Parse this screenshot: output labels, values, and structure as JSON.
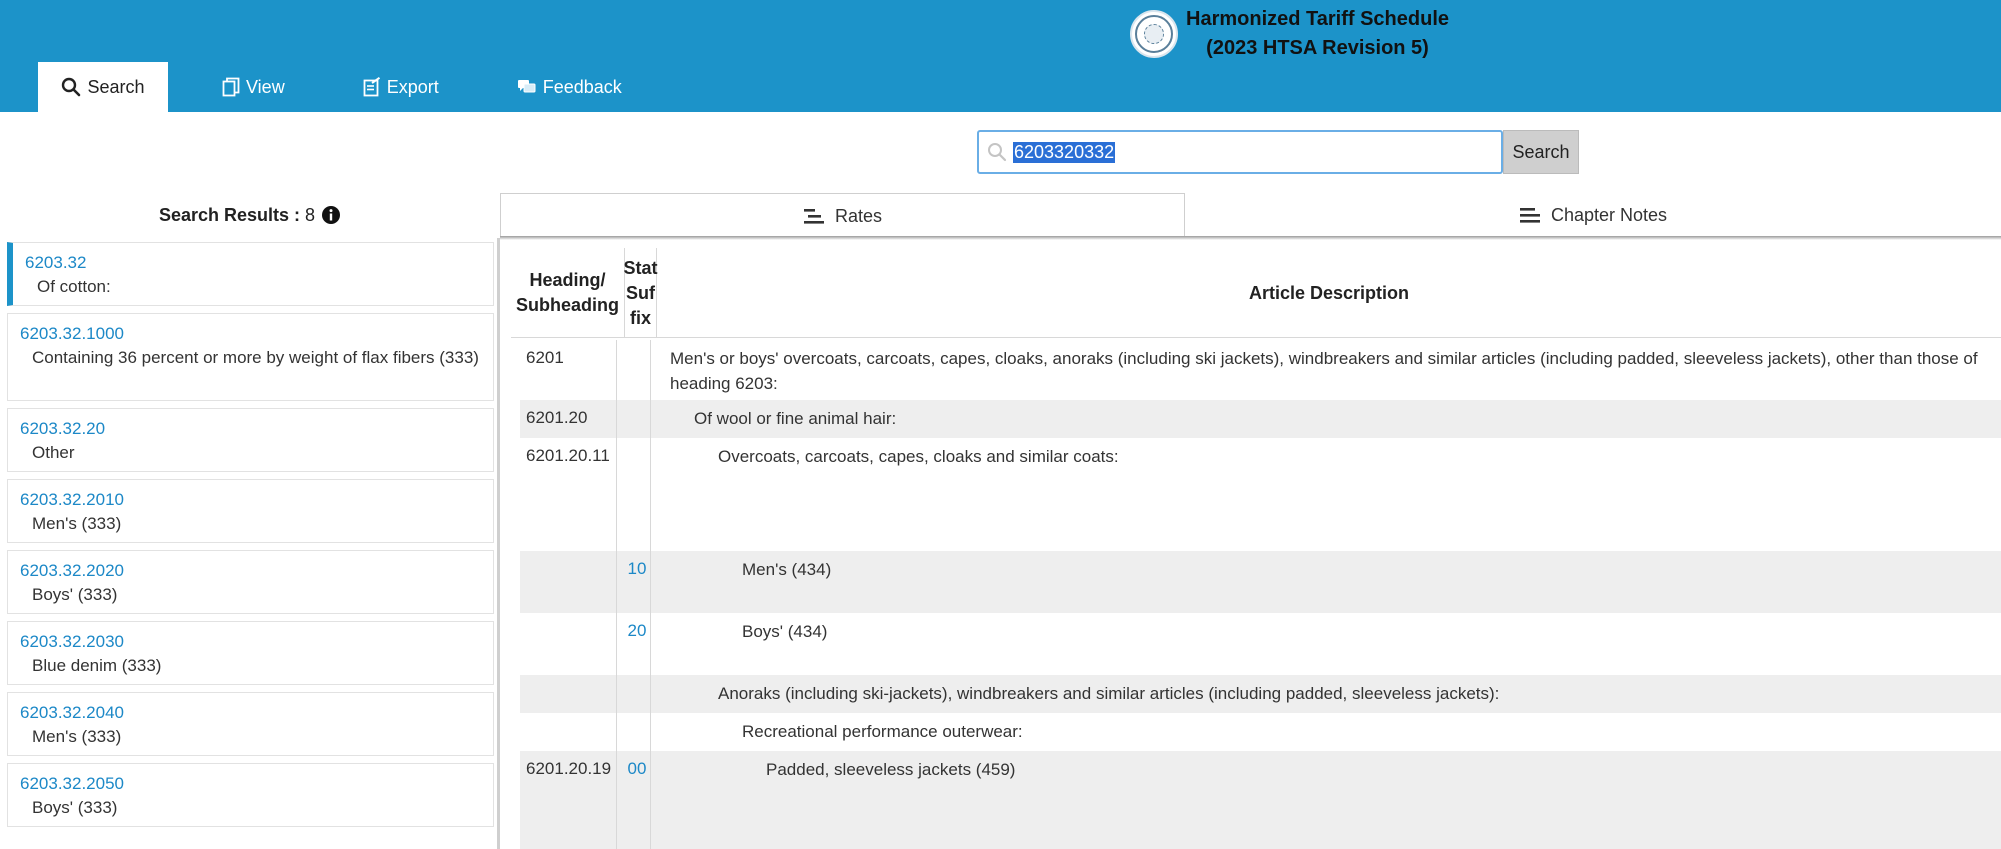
{
  "header": {
    "title_line1": "Harmonized Tariff Schedule",
    "title_line2": "(2023 HTSA Revision 5)",
    "tabs": [
      {
        "label": "Search",
        "icon": "search-icon"
      },
      {
        "label": "View",
        "icon": "copy-icon"
      },
      {
        "label": "Export",
        "icon": "export-icon"
      },
      {
        "label": "Feedback",
        "icon": "feedback-icon"
      }
    ]
  },
  "search": {
    "value": "6203320332",
    "button_label": "Search"
  },
  "results": {
    "label": "Search Results : ",
    "count": "8",
    "items": [
      {
        "code": "6203.32",
        "desc": "Of cotton:"
      },
      {
        "code": "6203.32.1000",
        "desc": "Containing 36 percent or more by weight of flax fibers (333)"
      },
      {
        "code": "6203.32.20",
        "desc": "Other"
      },
      {
        "code": "6203.32.2010",
        "desc": "Men's (333)"
      },
      {
        "code": "6203.32.2020",
        "desc": "Boys' (333)"
      },
      {
        "code": "6203.32.2030",
        "desc": "Blue denim (333)"
      },
      {
        "code": "6203.32.2040",
        "desc": "Men's (333)"
      },
      {
        "code": "6203.32.2050",
        "desc": "Boys' (333)"
      }
    ]
  },
  "view_tabs": {
    "rates": "Rates",
    "chapter_notes": "Chapter Notes"
  },
  "table": {
    "col_heading": "Heading/ Subheading",
    "col_stat": "Stat Suf fix",
    "col_desc": "Article Description",
    "rows": [
      {
        "heading": "6201",
        "stat": "",
        "desc": "Men's or boys' overcoats, carcoats, capes, cloaks, anoraks (including ski jackets), windbreakers and similar articles (including padded, sleeveless jackets), other than those of heading 6203:"
      },
      {
        "heading": "6201.20",
        "stat": "",
        "desc": "Of wool or fine animal hair:"
      },
      {
        "heading": "6201.20.11",
        "stat": "",
        "desc": "Overcoats, carcoats, capes, cloaks and similar coats:"
      },
      {
        "heading": "",
        "stat": "10",
        "desc": "Men's (434)"
      },
      {
        "heading": "",
        "stat": "20",
        "desc": "Boys' (434)"
      },
      {
        "heading": "",
        "stat": "",
        "desc": "Anoraks (including ski-jackets), windbreakers and similar articles (including padded, sleeveless jackets):"
      },
      {
        "heading": "",
        "stat": "",
        "desc": "Recreational performance outerwear:"
      },
      {
        "heading": "6201.20.19",
        "stat": "00",
        "desc": "Padded, sleeveless jackets (459)"
      }
    ]
  },
  "colors": {
    "header_bg": "#1c93c9",
    "link": "#1c88c7",
    "row_alt": "#eeeeee"
  }
}
